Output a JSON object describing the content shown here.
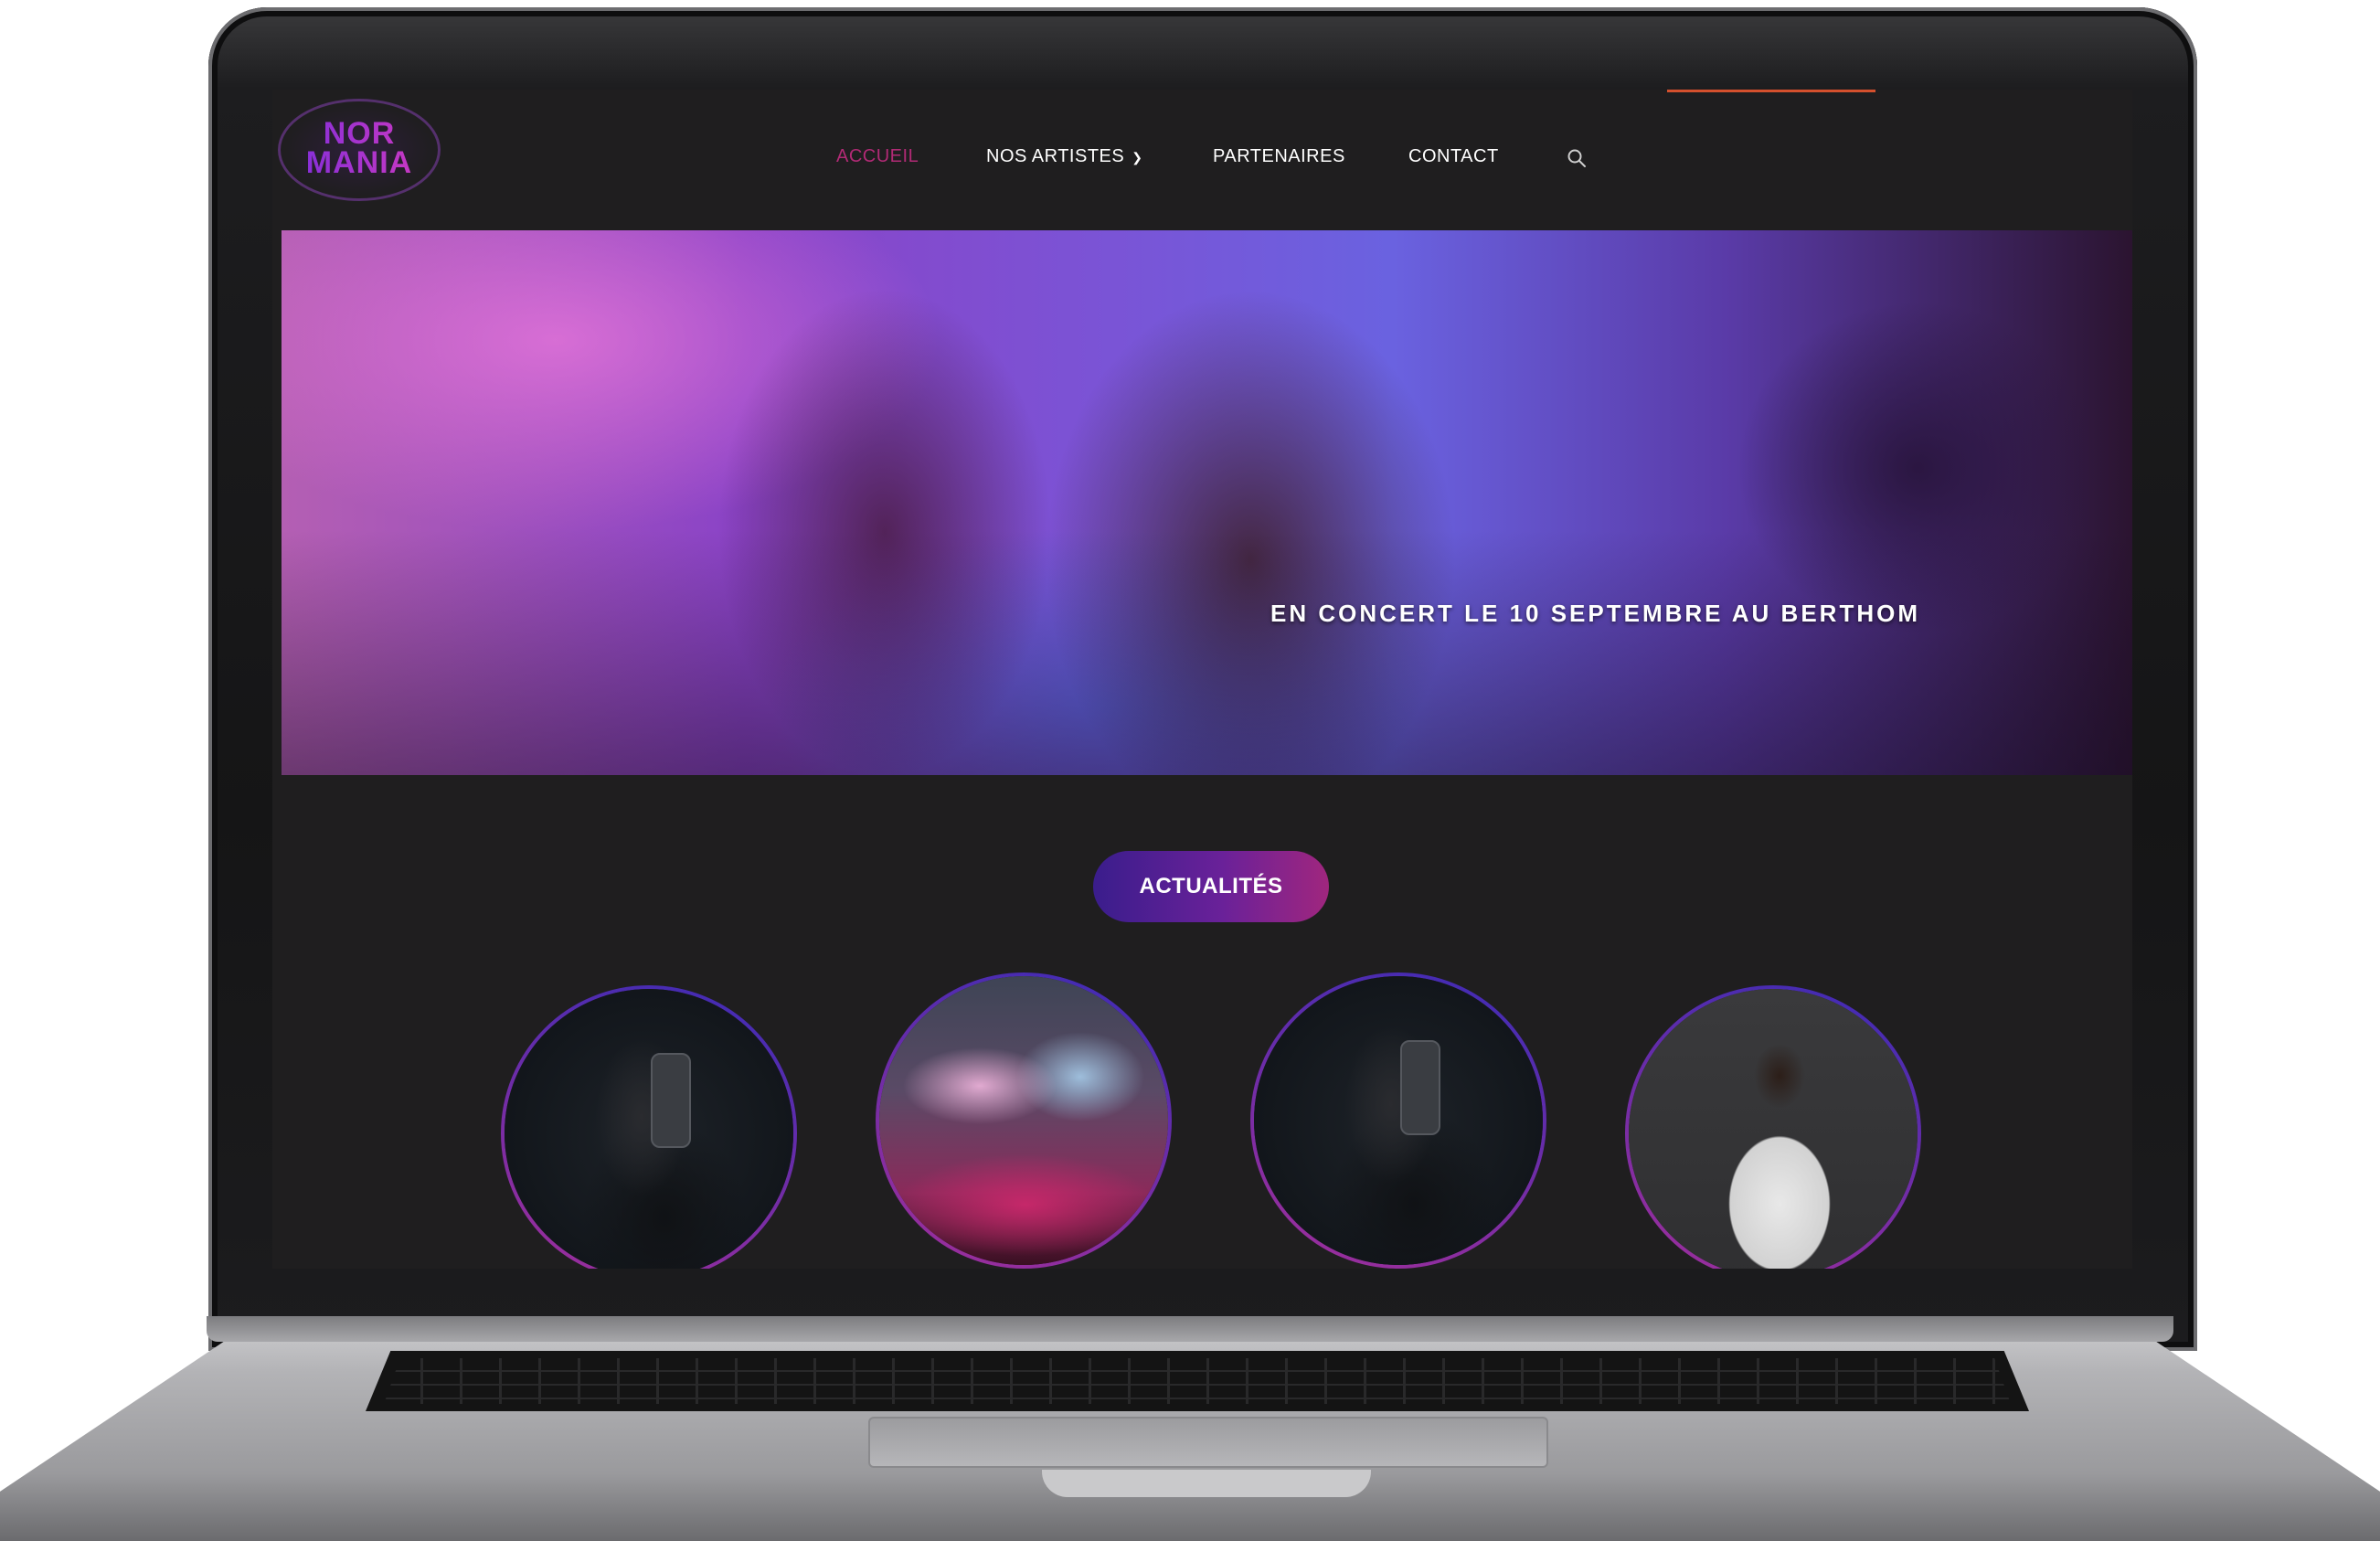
{
  "site": {
    "logo": {
      "line1": "NOR",
      "line2": "MANIA"
    },
    "nav": {
      "items": [
        {
          "label": "ACCUEIL",
          "active": true
        },
        {
          "label": "NOS ARTISTES",
          "has_dropdown": true
        },
        {
          "label": "PARTENAIRES"
        },
        {
          "label": "CONTACT"
        }
      ],
      "search_icon": "search-icon"
    },
    "hero": {
      "caption": "EN CONCERT LE 10 SEPTEMBRE AU BERTHOM"
    },
    "news": {
      "button_label": "ACTUALITÉS"
    },
    "thumbnails": [
      {
        "subject": "dj-headphones"
      },
      {
        "subject": "concert-crowd"
      },
      {
        "subject": "dj-headphones"
      },
      {
        "subject": "artist-white-tee"
      }
    ]
  },
  "colors": {
    "page_bg": "#1f1e1f",
    "active_nav": "#b12a75",
    "accent_line": "#d4502d",
    "button_gradient": [
      "#3a1d8c",
      "#a0267e"
    ],
    "circle_gradient": [
      "#3b2bb5",
      "#a12e9a"
    ]
  }
}
